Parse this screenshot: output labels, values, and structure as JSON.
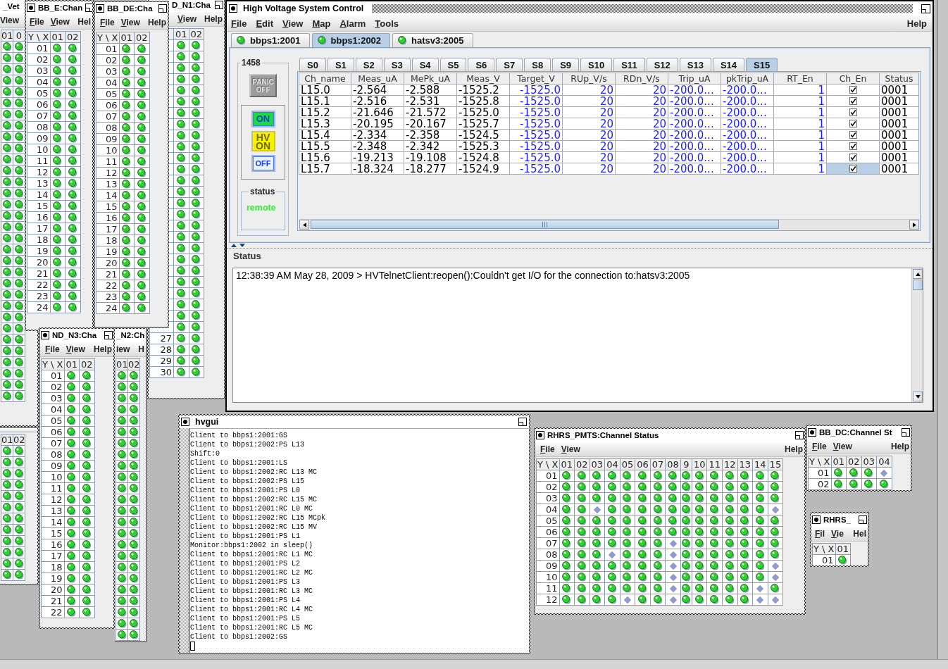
{
  "channel_windows": [
    {
      "title": "_Vet",
      "menu": [
        "View"
      ],
      "columns": [
        "01",
        "0"
      ],
      "rows": [
        {
          "leds": [
            true,
            true
          ]
        },
        {
          "leds": [
            true,
            true
          ]
        },
        {
          "leds": [
            true,
            true
          ]
        },
        {
          "leds": [
            true,
            true
          ]
        },
        {
          "leds": [
            true,
            true
          ]
        },
        {
          "leds": [
            true,
            true
          ]
        },
        {
          "leds": [
            true,
            true
          ]
        },
        {
          "leds": [
            true,
            true
          ]
        },
        {
          "leds": [
            true,
            true
          ]
        },
        {
          "leds": [
            true,
            true
          ]
        },
        {
          "leds": [
            true,
            true
          ]
        },
        {
          "leds": [
            true,
            true
          ]
        },
        {
          "leds": [
            true,
            true
          ]
        },
        {
          "leds": [
            true,
            true
          ]
        },
        {
          "leds": [
            true,
            true
          ]
        },
        {
          "leds": [
            true,
            true
          ]
        },
        {
          "leds": [
            true,
            true
          ]
        },
        {
          "leds": [
            true,
            true
          ]
        },
        {
          "leds": [
            true,
            true
          ]
        },
        {
          "leds": [
            true,
            true
          ]
        },
        {
          "leds": [
            true,
            true
          ]
        },
        {
          "leds": [
            true,
            true
          ]
        },
        {
          "leds": [
            true,
            true
          ]
        },
        {
          "leds": [
            true,
            true
          ]
        },
        {
          "leds": [
            true,
            true
          ]
        },
        {
          "leds": [
            true,
            true
          ]
        },
        {
          "leds": [
            true,
            true
          ]
        },
        {
          "leds": [
            true,
            true
          ]
        },
        {
          "leds": [
            true,
            true
          ]
        },
        {
          "leds": [
            true,
            true
          ]
        },
        {
          "leds": [
            true,
            true
          ]
        },
        {
          "leds": [
            true,
            true
          ]
        }
      ]
    },
    {
      "title": "BB_E:Chan",
      "menu": [
        "File",
        "View"
      ],
      "help": "Hel",
      "corner": "Y \\ X",
      "columns": [
        "01",
        "02"
      ],
      "rows": [
        {
          "label": "01",
          "leds": [
            true,
            true
          ]
        },
        {
          "label": "02",
          "leds": [
            true,
            true
          ]
        },
        {
          "label": "03",
          "leds": [
            true,
            true
          ]
        },
        {
          "label": "04",
          "leds": [
            true,
            true
          ]
        },
        {
          "label": "05",
          "leds": [
            true,
            true
          ]
        },
        {
          "label": "06",
          "leds": [
            true,
            true
          ]
        },
        {
          "label": "07",
          "leds": [
            true,
            true
          ]
        },
        {
          "label": "08",
          "leds": [
            true,
            true
          ]
        },
        {
          "label": "09",
          "leds": [
            true,
            true
          ]
        },
        {
          "label": "10",
          "leds": [
            true,
            true
          ]
        },
        {
          "label": "11",
          "leds": [
            true,
            true
          ]
        },
        {
          "label": "12",
          "leds": [
            true,
            true
          ]
        },
        {
          "label": "13",
          "leds": [
            true,
            true
          ]
        },
        {
          "label": "14",
          "leds": [
            true,
            true
          ]
        },
        {
          "label": "15",
          "leds": [
            true,
            true
          ]
        },
        {
          "label": "16",
          "leds": [
            true,
            true
          ]
        },
        {
          "label": "17",
          "leds": [
            true,
            true
          ]
        },
        {
          "label": "18",
          "leds": [
            true,
            true
          ]
        },
        {
          "label": "19",
          "leds": [
            true,
            true
          ]
        },
        {
          "label": "20",
          "leds": [
            true,
            true
          ]
        },
        {
          "label": "21",
          "leds": [
            true,
            true
          ]
        },
        {
          "label": "22",
          "leds": [
            true,
            true
          ]
        },
        {
          "label": "23",
          "leds": [
            true,
            true
          ]
        },
        {
          "label": "24",
          "leds": [
            true,
            true
          ]
        }
      ]
    },
    {
      "title": "BB_DE:Cha",
      "menu": [
        "File",
        "View"
      ],
      "help": "Help",
      "corner": "Y \\ X",
      "columns": [
        "01",
        "02"
      ],
      "rows": [
        {
          "label": "01",
          "leds": [
            true,
            true
          ]
        },
        {
          "label": "02",
          "leds": [
            true,
            true
          ]
        },
        {
          "label": "03",
          "leds": [
            true,
            true
          ]
        },
        {
          "label": "04",
          "leds": [
            true,
            true
          ]
        },
        {
          "label": "05",
          "leds": [
            true,
            true
          ]
        },
        {
          "label": "06",
          "leds": [
            true,
            true
          ]
        },
        {
          "label": "07",
          "leds": [
            true,
            true
          ]
        },
        {
          "label": "08",
          "leds": [
            true,
            true
          ]
        },
        {
          "label": "09",
          "leds": [
            true,
            true
          ]
        },
        {
          "label": "10",
          "leds": [
            true,
            true
          ]
        },
        {
          "label": "11",
          "leds": [
            true,
            true
          ]
        },
        {
          "label": "12",
          "leds": [
            true,
            true
          ]
        },
        {
          "label": "13",
          "leds": [
            true,
            true
          ]
        },
        {
          "label": "14",
          "leds": [
            true,
            true
          ]
        },
        {
          "label": "15",
          "leds": [
            true,
            true
          ]
        },
        {
          "label": "16",
          "leds": [
            true,
            true
          ]
        },
        {
          "label": "17",
          "leds": [
            true,
            true
          ]
        },
        {
          "label": "18",
          "leds": [
            true,
            true
          ]
        },
        {
          "label": "19",
          "leds": [
            true,
            true
          ]
        },
        {
          "label": "20",
          "leds": [
            true,
            true
          ]
        },
        {
          "label": "21",
          "leds": [
            true,
            true
          ]
        },
        {
          "label": "22",
          "leds": [
            true,
            true
          ]
        },
        {
          "label": "23",
          "leds": [
            true,
            true
          ]
        },
        {
          "label": "24",
          "leds": [
            true,
            true
          ]
        }
      ]
    },
    {
      "title": "D_N1:Cha",
      "menu": [
        "View"
      ],
      "help": "Help",
      "columns": [
        "01",
        "02"
      ],
      "rows": [
        {
          "leds": [
            true,
            true
          ]
        },
        {
          "leds": [
            true,
            true
          ]
        },
        {
          "leds": [
            true,
            true
          ]
        },
        {
          "leds": [
            true,
            true
          ]
        },
        {
          "leds": [
            true,
            true
          ]
        },
        {
          "leds": [
            true,
            true
          ]
        },
        {
          "leds": [
            true,
            true
          ]
        },
        {
          "leds": [
            true,
            true
          ]
        },
        {
          "leds": [
            true,
            true
          ]
        },
        {
          "leds": [
            true,
            true
          ]
        },
        {
          "leds": [
            true,
            true
          ]
        },
        {
          "leds": [
            true,
            true
          ]
        },
        {
          "leds": [
            true,
            true
          ]
        },
        {
          "leds": [
            true,
            true
          ]
        },
        {
          "leds": [
            true,
            true
          ]
        },
        {
          "leds": [
            true,
            true
          ]
        },
        {
          "leds": [
            true,
            true
          ]
        },
        {
          "leds": [
            true,
            true
          ]
        },
        {
          "leds": [
            true,
            true
          ]
        },
        {
          "leds": [
            true,
            true
          ]
        },
        {
          "leds": [
            true,
            true
          ]
        },
        {
          "leds": [
            true,
            true
          ]
        },
        {
          "leds": [
            true,
            true
          ]
        },
        {
          "leds": [
            true,
            true
          ]
        },
        {
          "leds": [
            true,
            true
          ]
        },
        {
          "leds": [
            true,
            true
          ]
        },
        {
          "label": "27",
          "leds": [
            true,
            true
          ]
        },
        {
          "label": "28",
          "leds": [
            true,
            true
          ]
        },
        {
          "label": "29",
          "leds": [
            true,
            true
          ]
        },
        {
          "label": "30",
          "leds": [
            true,
            true
          ]
        }
      ]
    },
    {
      "title": "ND_N3:Cha",
      "menu": [
        "File",
        "View"
      ],
      "help": "Help",
      "corner": "Y \\ X",
      "columns": [
        "01",
        "02"
      ],
      "rows": [
        {
          "label": "01",
          "leds": [
            true,
            true
          ]
        },
        {
          "label": "02",
          "leds": [
            true,
            true
          ]
        },
        {
          "label": "03",
          "leds": [
            true,
            true
          ]
        },
        {
          "label": "04",
          "leds": [
            true,
            true
          ]
        },
        {
          "label": "05",
          "leds": [
            true,
            true
          ]
        },
        {
          "label": "06",
          "leds": [
            true,
            true
          ]
        },
        {
          "label": "07",
          "leds": [
            true,
            true
          ]
        },
        {
          "label": "08",
          "leds": [
            true,
            true
          ]
        },
        {
          "label": "09",
          "leds": [
            true,
            true
          ]
        },
        {
          "label": "10",
          "leds": [
            true,
            true
          ]
        },
        {
          "label": "11",
          "leds": [
            true,
            true
          ]
        },
        {
          "label": "12",
          "leds": [
            true,
            true
          ]
        },
        {
          "label": "13",
          "leds": [
            true,
            true
          ]
        },
        {
          "label": "14",
          "leds": [
            true,
            true
          ]
        },
        {
          "label": "15",
          "leds": [
            true,
            true
          ]
        },
        {
          "label": "16",
          "leds": [
            true,
            true
          ]
        },
        {
          "label": "17",
          "leds": [
            true,
            true
          ]
        },
        {
          "label": "18",
          "leds": [
            true,
            true
          ]
        },
        {
          "label": "19",
          "leds": [
            true,
            true
          ]
        },
        {
          "label": "20",
          "leds": [
            true,
            true
          ]
        },
        {
          "label": "21",
          "leds": [
            true,
            true
          ]
        },
        {
          "label": "22",
          "leds": [
            true,
            true
          ]
        }
      ]
    },
    {
      "title": "_N2:Ch",
      "menu": [
        "iew"
      ],
      "help": "H",
      "columns": [
        "01",
        "02"
      ],
      "rows": [
        {
          "leds": [
            true,
            true
          ]
        },
        {
          "leds": [
            true,
            true
          ]
        },
        {
          "leds": [
            true,
            true
          ]
        },
        {
          "leds": [
            true,
            true
          ]
        },
        {
          "leds": [
            true,
            true
          ]
        },
        {
          "leds": [
            true,
            true
          ]
        },
        {
          "leds": [
            true,
            true
          ]
        },
        {
          "leds": [
            true,
            true
          ]
        },
        {
          "leds": [
            true,
            true
          ]
        },
        {
          "leds": [
            true,
            true
          ]
        },
        {
          "leds": [
            true,
            true
          ]
        },
        {
          "leds": [
            true,
            true
          ]
        },
        {
          "leds": [
            true,
            true
          ]
        },
        {
          "leds": [
            true,
            true
          ]
        },
        {
          "leds": [
            true,
            true
          ]
        },
        {
          "leds": [
            true,
            true
          ]
        },
        {
          "leds": [
            true,
            true
          ]
        },
        {
          "leds": [
            true,
            true
          ]
        },
        {
          "leds": [
            true,
            true
          ]
        },
        {
          "leds": [
            true,
            true
          ]
        },
        {
          "leds": [
            true,
            true
          ]
        },
        {
          "leds": [
            true,
            true
          ]
        },
        {
          "leds": [
            true,
            true
          ]
        },
        {
          "leds": [
            true,
            true
          ]
        }
      ]
    },
    {
      "columns": [
        "01",
        "02"
      ],
      "rows": [
        {
          "leds": [
            true,
            true
          ]
        },
        {
          "leds": [
            true,
            true
          ]
        },
        {
          "leds": [
            true,
            true
          ]
        },
        {
          "leds": [
            true,
            true
          ]
        },
        {
          "leds": [
            true,
            true
          ]
        },
        {
          "leds": [
            true,
            true
          ]
        },
        {
          "leds": [
            true,
            true
          ]
        },
        {
          "leds": [
            true,
            true
          ]
        },
        {
          "leds": [
            true,
            true
          ]
        },
        {
          "leds": [
            true,
            true
          ]
        },
        {
          "leds": [
            true,
            true
          ]
        },
        {
          "leds": [
            true,
            true
          ]
        }
      ]
    },
    {
      "title": "RHRS_PMTS:Channel Status",
      "menu": [
        "File",
        "View"
      ],
      "help": "Help",
      "corner": "Y \\ X",
      "columns": [
        "01",
        "02",
        "03",
        "04",
        "05",
        "06",
        "07",
        "08",
        "9",
        "10",
        "11",
        "12",
        "13",
        "14",
        "15"
      ],
      "rows": [
        {
          "label": "01",
          "leds": [
            true,
            true,
            true,
            true,
            true,
            true,
            true,
            true,
            true,
            true,
            true,
            true,
            true,
            true,
            true
          ]
        },
        {
          "label": "02",
          "leds": [
            true,
            true,
            true,
            true,
            true,
            true,
            true,
            true,
            true,
            true,
            true,
            true,
            true,
            true,
            true
          ]
        },
        {
          "label": "03",
          "leds": [
            true,
            true,
            true,
            true,
            true,
            true,
            true,
            true,
            true,
            true,
            true,
            true,
            true,
            true,
            true
          ]
        },
        {
          "label": "04",
          "leds": [
            true,
            true,
            false,
            true,
            true,
            true,
            true,
            true,
            true,
            true,
            true,
            true,
            true,
            true,
            false
          ]
        },
        {
          "label": "05",
          "leds": [
            true,
            true,
            true,
            true,
            true,
            true,
            true,
            true,
            true,
            true,
            true,
            true,
            true,
            true,
            true
          ]
        },
        {
          "label": "06",
          "leds": [
            true,
            true,
            true,
            true,
            true,
            true,
            true,
            true,
            true,
            true,
            true,
            true,
            true,
            true,
            true
          ]
        },
        {
          "label": "07",
          "leds": [
            true,
            true,
            true,
            true,
            true,
            true,
            true,
            false,
            true,
            true,
            true,
            true,
            true,
            true,
            true
          ]
        },
        {
          "label": "08",
          "leds": [
            true,
            true,
            true,
            false,
            true,
            true,
            true,
            false,
            true,
            true,
            true,
            true,
            true,
            true,
            true
          ]
        },
        {
          "label": "09",
          "leds": [
            true,
            true,
            true,
            true,
            true,
            true,
            true,
            false,
            true,
            true,
            true,
            true,
            true,
            true,
            false
          ]
        },
        {
          "label": "10",
          "leds": [
            true,
            true,
            true,
            true,
            true,
            true,
            true,
            false,
            true,
            true,
            true,
            true,
            true,
            true,
            false
          ]
        },
        {
          "label": "11",
          "leds": [
            true,
            true,
            true,
            true,
            true,
            true,
            true,
            false,
            true,
            true,
            true,
            true,
            true,
            false,
            true
          ]
        },
        {
          "label": "12",
          "leds": [
            true,
            true,
            true,
            true,
            false,
            true,
            true,
            false,
            true,
            true,
            true,
            true,
            true,
            false,
            false
          ]
        }
      ]
    },
    {
      "title": "BB_DC:Channel St",
      "menu": [
        "File",
        "View"
      ],
      "help": "Help",
      "corner": "Y \\ X",
      "columns": [
        "01",
        "02",
        "03",
        "04"
      ],
      "rows": [
        {
          "label": "01",
          "leds": [
            true,
            true,
            true,
            false
          ]
        },
        {
          "label": "02",
          "leds": [
            true,
            true,
            true,
            true
          ]
        }
      ]
    },
    {
      "title": "RHRS_",
      "menu": [
        "Fil",
        "Vie"
      ],
      "help": "Hel",
      "corner": "Y \\ X",
      "columns": [
        "01"
      ],
      "rows": [
        {
          "label": "01",
          "leds": [
            true
          ]
        }
      ]
    }
  ],
  "main_window": {
    "title": "High Voltage System Control",
    "menu": [
      "File",
      "Edit",
      "View",
      "Map",
      "Alarm",
      "Tools"
    ],
    "help": "Help",
    "host_tabs": [
      {
        "label": "bbps1:2001",
        "online": true,
        "selected": false
      },
      {
        "label": "bbps1:2002",
        "online": true,
        "selected": true
      },
      {
        "label": "hatsv3:2005",
        "online": true,
        "selected": false
      }
    ],
    "crate": {
      "title": "1458",
      "panic": "PANIC OFF",
      "buttons": [
        {
          "kind": "on",
          "label": "ON"
        },
        {
          "kind": "hv",
          "label": "HV ON"
        },
        {
          "kind": "off",
          "label": "OFF"
        }
      ],
      "status_title": "status",
      "status": "remote"
    },
    "slot_tabs": [
      {
        "label": "S0",
        "selected": false
      },
      {
        "label": "S1",
        "selected": false
      },
      {
        "label": "S2",
        "selected": false
      },
      {
        "label": "S3",
        "selected": false
      },
      {
        "label": "S4",
        "selected": false
      },
      {
        "label": "S5",
        "selected": false
      },
      {
        "label": "S6",
        "selected": false
      },
      {
        "label": "S7",
        "selected": false
      },
      {
        "label": "S8",
        "selected": false
      },
      {
        "label": "S9",
        "selected": false
      },
      {
        "label": "S10",
        "selected": false
      },
      {
        "label": "S11",
        "selected": false
      },
      {
        "label": "S12",
        "selected": false
      },
      {
        "label": "S13",
        "selected": false
      },
      {
        "label": "S14",
        "selected": false
      },
      {
        "label": "S15",
        "selected": true
      }
    ],
    "table": {
      "columns": [
        {
          "label": "Ch_name",
          "kind": "readout"
        },
        {
          "label": "Meas_uA",
          "kind": "readout"
        },
        {
          "label": "MePk_uA",
          "kind": "readout"
        },
        {
          "label": "Meas_V",
          "kind": "readout"
        },
        {
          "label": "Target_V",
          "kind": "setting"
        },
        {
          "label": "RUp_V/s",
          "kind": "setting"
        },
        {
          "label": "RDn_V/s",
          "kind": "setting"
        },
        {
          "label": "Trip_uA",
          "kind": "limit"
        },
        {
          "label": "pkTrip_uA",
          "kind": "limit"
        },
        {
          "label": "RT_En",
          "kind": "setting"
        },
        {
          "label": "Ch_En",
          "kind": "check"
        },
        {
          "label": "Status",
          "kind": "readout"
        }
      ],
      "rows": [
        {
          "cells": [
            "L15.0",
            "-2.564",
            "-2.588",
            "-1525.2",
            "-1525.0",
            "20",
            "20",
            "-200.0...",
            "-200.0...",
            "1",
            true,
            "0001"
          ],
          "selected": false
        },
        {
          "cells": [
            "L15.1",
            "-2.516",
            "-2.531",
            "-1525.8",
            "-1525.0",
            "20",
            "20",
            "-200.0...",
            "-200.0...",
            "1",
            true,
            "0001"
          ],
          "selected": false
        },
        {
          "cells": [
            "L15.2",
            "-21.646",
            "-21.572",
            "-1525.0",
            "-1525.0",
            "20",
            "20",
            "-200.0...",
            "-200.0...",
            "1",
            true,
            "0001"
          ],
          "selected": false
        },
        {
          "cells": [
            "L15.3",
            "-20.195",
            "-20.167",
            "-1525.7",
            "-1525.0",
            "20",
            "20",
            "-200.0...",
            "-200.0...",
            "1",
            true,
            "0001"
          ],
          "selected": false
        },
        {
          "cells": [
            "L15.4",
            "-2.334",
            "-2.358",
            "-1524.5",
            "-1525.0",
            "20",
            "20",
            "-200.0...",
            "-200.0...",
            "1",
            true,
            "0001"
          ],
          "selected": false
        },
        {
          "cells": [
            "L15.5",
            "-2.348",
            "-2.342",
            "-1525.3",
            "-1525.0",
            "20",
            "20",
            "-200.0...",
            "-200.0...",
            "1",
            true,
            "0001"
          ],
          "selected": false
        },
        {
          "cells": [
            "L15.6",
            "-19.213",
            "-19.108",
            "-1524.8",
            "-1525.0",
            "20",
            "20",
            "-200.0...",
            "-200.0...",
            "1",
            true,
            "0001"
          ],
          "selected": false
        },
        {
          "cells": [
            "L15.7",
            "-18.324",
            "-18.277",
            "-1524.9",
            "-1525.0",
            "20",
            "20",
            "-200.0...",
            "-200.0...",
            "1",
            true,
            "0001"
          ],
          "selected": true
        }
      ]
    },
    "log_label": "Status",
    "log": "12:38:39 AM May 28, 2009 > HVTelnetClient:reopen():Couldn't get I/O for the connection to:hatsv3:2005"
  },
  "log_window": {
    "title": "hvgui",
    "lines": [
      "Client to bbps1:2001:GS",
      "Client to bbps1:2002:PS L13",
      "Shift:0",
      "Client to bbps1:2001:LS",
      "Client to bbps1:2002:RC L13 MC",
      "Client to bbps1:2002:PS L15",
      "Client to bbps1:2001:PS L0",
      "Client to bbps1:2002:RC L15 MC",
      "Client to bbps1:2001:RC L0 MC",
      "Client to bbps1:2002:RC L15 MCpk",
      "Client to bbps1:2002:RC L15 MV",
      "Client to bbps1:2001:PS L1",
      "Monitor:bbps1:2002 in sleep()",
      "Client to bbps1:2001:RC L1 MC",
      "Client to bbps1:2001:PS L2",
      "Client to bbps1:2001:RC L2 MC",
      "Client to bbps1:2001:PS L3",
      "Client to bbps1:2001:RC L3 MC",
      "Client to bbps1:2001:PS L4",
      "Client to bbps1:2001:RC L4 MC",
      "Client to bbps1:2001:PS L5",
      "Client to bbps1:2001:RC L5 MC",
      "Client to bbps1:2002:GS"
    ]
  }
}
